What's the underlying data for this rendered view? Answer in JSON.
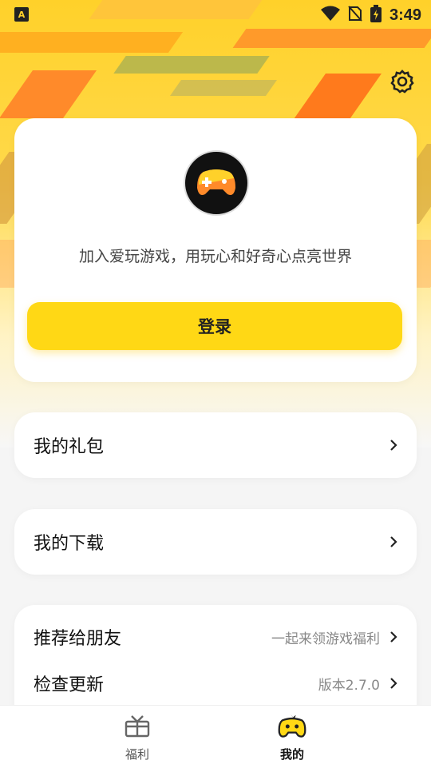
{
  "status": {
    "time": "3:49",
    "app_badge": "A"
  },
  "profile": {
    "slogan": "加入爱玩游戏，用玩心和好奇心点亮世界",
    "login_label": "登录"
  },
  "menu": {
    "gift_label": "我的礼包",
    "download_label": "我的下载",
    "recommend_label": "推荐给朋友",
    "recommend_sub": "一起来领游戏福利",
    "update_label": "检查更新",
    "update_sub": "版本2.7.0"
  },
  "tabs": [
    {
      "label": "福利",
      "icon": "gift-icon",
      "active": false
    },
    {
      "label": "我的",
      "icon": "gamepad-mascot-icon",
      "active": true
    }
  ],
  "colors": {
    "accent": "#ffd815",
    "orange": "#ff8a2a",
    "text": "#111111",
    "muted": "#888888"
  }
}
